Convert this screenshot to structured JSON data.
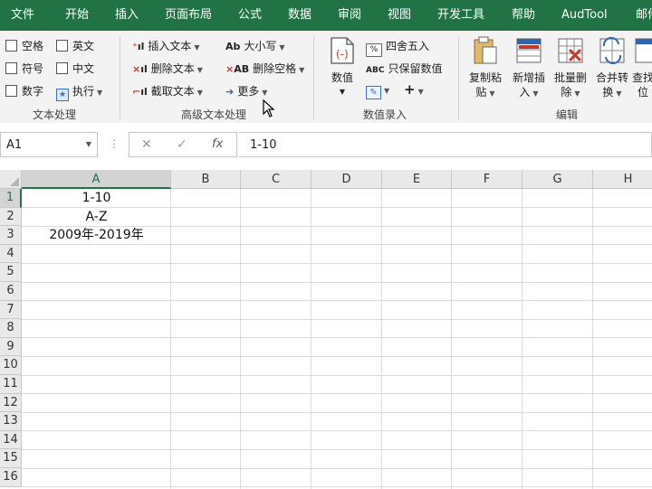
{
  "menu": {
    "tabs": [
      "文件",
      "开始",
      "插入",
      "页面布局",
      "公式",
      "数据",
      "审阅",
      "视图",
      "开发工具",
      "帮助",
      "AudTool",
      "邮件"
    ]
  },
  "ribbon": {
    "text_group": {
      "label": "文本处理",
      "items": [
        "空格",
        "英文",
        "符号",
        "中文",
        "数字",
        "执行"
      ]
    },
    "adv_group": {
      "label": "高级文本处理",
      "insert_text": "插入文本",
      "delete_text": "删除文本",
      "extract_text": "截取文本",
      "case": "大小写",
      "delete_space": "删除空格",
      "more": "更多"
    },
    "num_group": {
      "label": "数值录入",
      "value_line1": "数值",
      "round": "四舍五入",
      "keep_values": "只保留数值",
      "plus": "+"
    },
    "edit_group": {
      "label": "编辑",
      "copy_paste": [
        "复制粘",
        "贴"
      ],
      "new_insert": [
        "新增插",
        "入"
      ],
      "batch_delete": [
        "批量删",
        "除"
      ],
      "merge": [
        "合并转",
        "换"
      ],
      "find": [
        "查找",
        "位"
      ]
    },
    "icon_text": {
      "ab": "Ab",
      "abc": "ABC",
      "xab": "AB",
      "percent": "%"
    }
  },
  "formula_bar": {
    "name_box": "A1",
    "cancel_symbol": "✕",
    "confirm_symbol": "✓",
    "fx": "fx",
    "content": "1-10"
  },
  "sheet": {
    "columns": [
      "A",
      "B",
      "C",
      "D",
      "E",
      "F",
      "G",
      "H"
    ],
    "rows": [
      "1",
      "2",
      "3",
      "4",
      "5",
      "6",
      "7",
      "8",
      "9",
      "10",
      "11",
      "12",
      "13",
      "14",
      "15",
      "16"
    ],
    "cells": {
      "A1": "1-10",
      "A2": "A-Z",
      "A3": "2009年-2019年"
    }
  },
  "colors": {
    "accent": "#217346",
    "ribbon_bg": "#f3f3f3"
  }
}
